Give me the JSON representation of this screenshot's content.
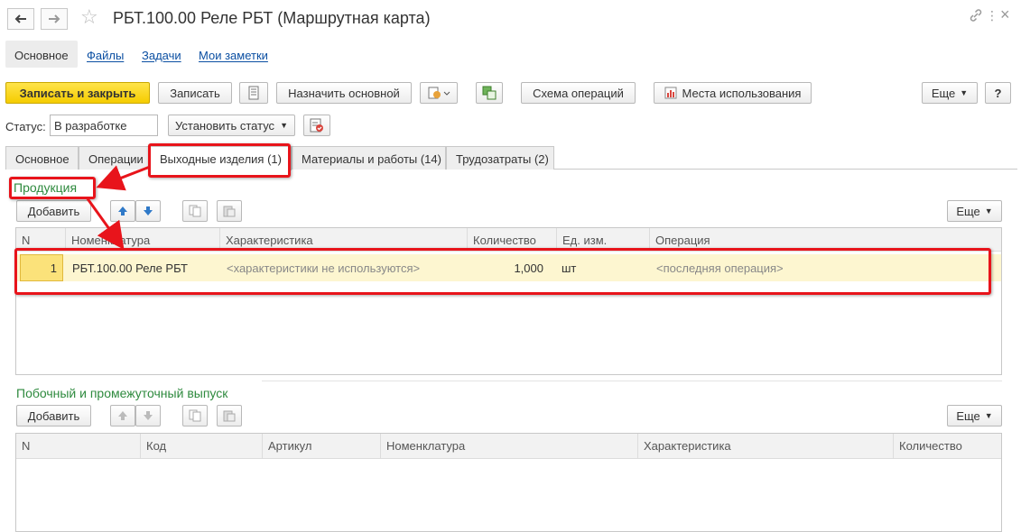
{
  "window": {
    "title": "РБТ.100.00 Реле РБТ (Маршрутная карта)"
  },
  "nav_tabs": [
    "Основное",
    "Файлы",
    "Задачи",
    "Мои заметки"
  ],
  "toolbar": {
    "save_close": "Записать и закрыть",
    "save": "Записать",
    "assign_main": "Назначить основной",
    "operations_scheme": "Схема операций",
    "usage_places": "Места использования",
    "more": "Еще",
    "help": "?"
  },
  "status": {
    "label": "Статус:",
    "value": "В разработке",
    "set_status": "Установить статус"
  },
  "form_tabs": [
    "Основное",
    "Операции",
    "Выходные изделия (1)",
    "Материалы и работы (14)",
    "Трудозатраты (2)"
  ],
  "products": {
    "title": "Продукция",
    "add": "Добавить",
    "more": "Еще",
    "columns": [
      "N",
      "Номенклатура",
      "Характеристика",
      "Количество",
      "Ед. изм.",
      "Операция"
    ],
    "rows": [
      {
        "n": "1",
        "nomenclature": "РБТ.100.00 Реле РБТ",
        "characteristic": "<характеристики не используются>",
        "quantity": "1,000",
        "unit": "шт",
        "operation": "<последняя операция>"
      }
    ]
  },
  "byproducts": {
    "title": "Побочный и промежуточный выпуск",
    "add": "Добавить",
    "more": "Еще",
    "columns": [
      "N",
      "Код",
      "Артикул",
      "Номенклатура",
      "Характеристика",
      "Количество"
    ]
  },
  "colors": {
    "highlight": "#e8141b",
    "group_title": "#2e8a3e",
    "primary_button": "#f5cc00",
    "selected_row": "#fdf6d0"
  }
}
